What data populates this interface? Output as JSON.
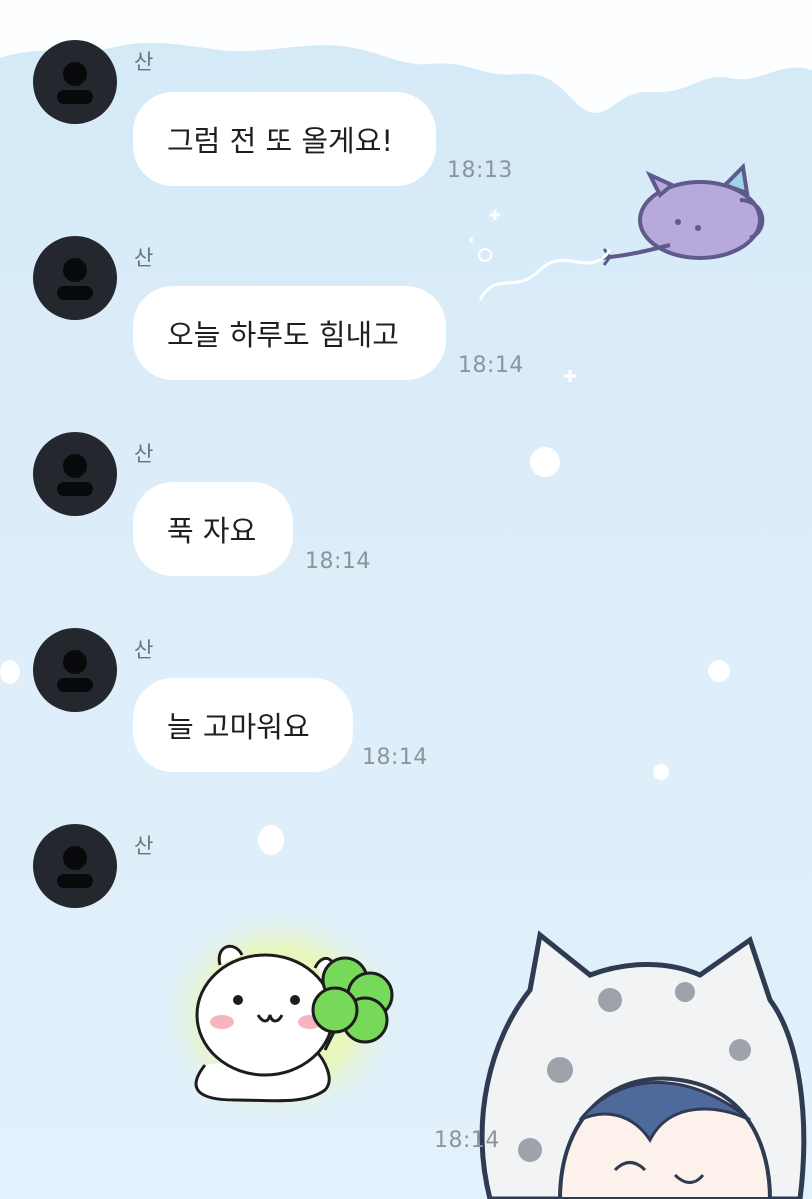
{
  "messages": [
    {
      "sender": "산",
      "text": "그럼 전 또 올게요!",
      "time": "18:13"
    },
    {
      "sender": "산",
      "text": "오늘 하루도 힘내고",
      "time": "18:14"
    },
    {
      "sender": "산",
      "text": "푹 자요",
      "time": "18:14"
    },
    {
      "sender": "산",
      "text": "늘 고마워요",
      "time": "18:14"
    },
    {
      "sender": "산",
      "sticker": "hamster-with-clover-sticker",
      "time": "18:14"
    }
  ],
  "theme": {
    "bubble_color": "#ffffff",
    "background_color": "#dcedf9",
    "avatar_color": "#25272e"
  },
  "icons": {
    "avatar": "default-profile-icon",
    "decor_1": "purple-cat-doodle",
    "decor_2": "hooded-character-illustration"
  }
}
